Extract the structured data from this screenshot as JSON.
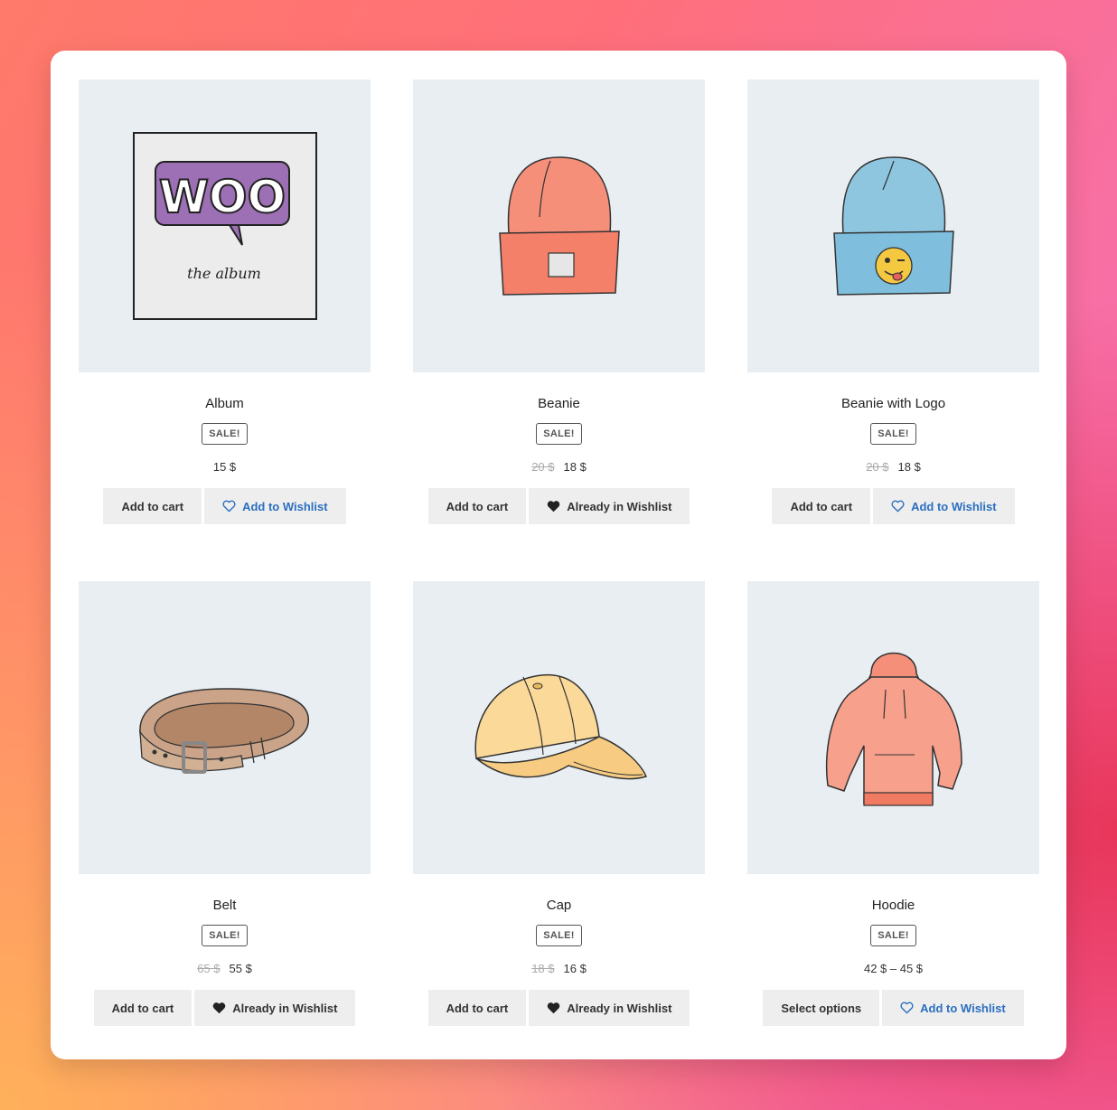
{
  "products": [
    {
      "name": "Album",
      "badge": "SALE!",
      "old_price": "",
      "price": "15 $",
      "cart": "Add to cart",
      "wishlist": "Add to Wishlist",
      "wish_state": "add",
      "image": "woo-album",
      "album_logo": "WOO",
      "album_caption": "the album"
    },
    {
      "name": "Beanie",
      "badge": "SALE!",
      "old_price": "20 $",
      "price": "18 $",
      "cart": "Add to cart",
      "wishlist": "Already in Wishlist",
      "wish_state": "in",
      "image": "beanie-orange"
    },
    {
      "name": "Beanie with Logo",
      "badge": "SALE!",
      "old_price": "20 $",
      "price": "18 $",
      "cart": "Add to cart",
      "wishlist": "Add to Wishlist",
      "wish_state": "add",
      "image": "beanie-blue-logo"
    },
    {
      "name": "Belt",
      "badge": "SALE!",
      "old_price": "65 $",
      "price": "55 $",
      "cart": "Add to cart",
      "wishlist": "Already in Wishlist",
      "wish_state": "in",
      "image": "belt"
    },
    {
      "name": "Cap",
      "badge": "SALE!",
      "old_price": "18 $",
      "price": "16 $",
      "cart": "Add to cart",
      "wishlist": "Already in Wishlist",
      "wish_state": "in",
      "image": "cap"
    },
    {
      "name": "Hoodie",
      "badge": "SALE!",
      "old_price": "",
      "price": "42 $ – 45 $",
      "cart": "Select options",
      "wishlist": "Add to Wishlist",
      "wish_state": "add",
      "image": "hoodie"
    }
  ],
  "colors": {
    "wishlist_link": "#2a6fbf",
    "thumb_bg": "#e8eef2",
    "button_bg": "#eeeeee"
  }
}
